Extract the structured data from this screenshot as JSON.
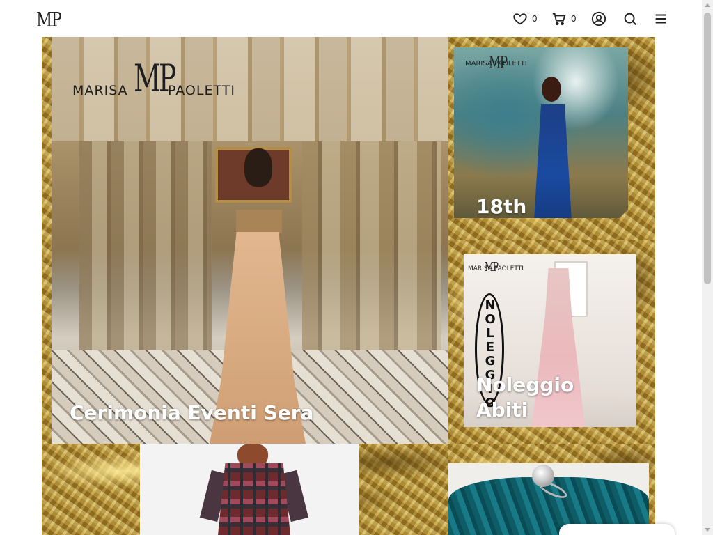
{
  "header": {
    "logo_text": "MP",
    "wishlist_count": "0",
    "cart_count": "0"
  },
  "tiles": {
    "main": {
      "title": "Cerimonia Eventi Sera",
      "logo_mp": "MP",
      "logo_name_first": "MARISA",
      "logo_name_last": "PAOLETTI"
    },
    "eighteenth": {
      "title": "18th",
      "logo_mp": "MP",
      "logo_name": "MARISA    PAOLETTI"
    },
    "rent": {
      "title_line1": "Noleggio",
      "title_line2": "Abiti",
      "logo_mp": "MP",
      "logo_name": "MARISA    PAOLETTI",
      "badge_vertical": "NOLEGGIO"
    }
  }
}
